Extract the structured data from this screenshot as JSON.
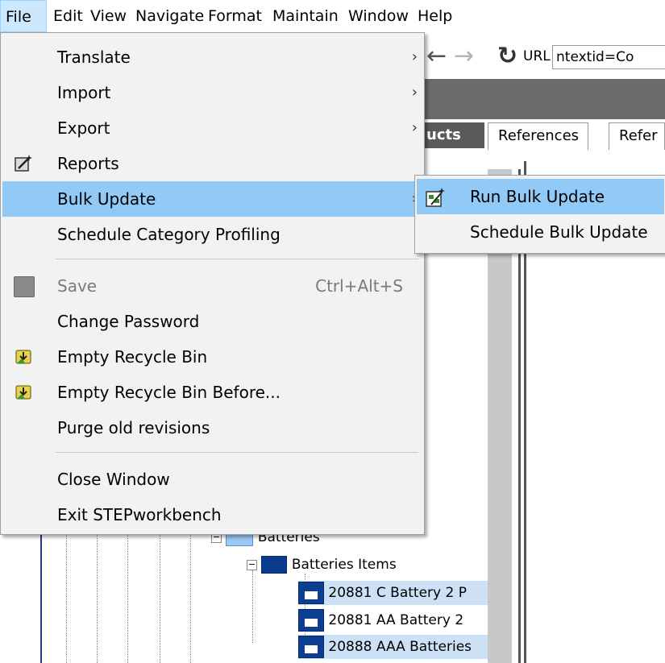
{
  "menubar": {
    "items": [
      "File",
      "Edit",
      "View",
      "Navigate",
      "Format",
      "Maintain",
      "Window",
      "Help"
    ]
  },
  "toolbar": {
    "url_label": "URL",
    "url_value": "ntextid=Co"
  },
  "tabs": {
    "products": "ucts",
    "references": "References",
    "refer": "Refer"
  },
  "tree": {
    "batteries": "Batteries",
    "batteries_items": "Batteries Items",
    "items": [
      {
        "label": "20881 C Battery 2 P",
        "selected": true
      },
      {
        "label": "20881 AA Battery 2",
        "selected": false
      },
      {
        "label": "20888 AAA Batteries",
        "selected": true
      }
    ]
  },
  "file_menu": {
    "translate": "Translate",
    "import": "Import",
    "export": "Export",
    "reports": "Reports",
    "bulk_update": "Bulk Update",
    "schedule_category_profiling": "Schedule Category Profiling",
    "save": "Save",
    "save_shortcut": "Ctrl+Alt+S",
    "change_password": "Change Password",
    "empty_recycle_bin": "Empty Recycle Bin",
    "empty_recycle_bin_before": "Empty Recycle Bin Before...",
    "purge_old_revisions": "Purge old revisions",
    "close_window": "Close Window",
    "exit": "Exit STEPworkbench"
  },
  "bulk_update_submenu": {
    "run_bulk_update": "Run Bulk Update",
    "schedule_bulk_update": "Schedule Bulk Update"
  },
  "icons": {
    "back": "arrow-left-icon",
    "forward": "arrow-right-icon",
    "refresh": "refresh-icon",
    "reports": "wand-icon",
    "save": "floppy-disk-icon",
    "recycle": "recycle-bin-icon",
    "run_bulk": "bulk-update-icon"
  },
  "colors": {
    "highlight": "#91c9f7",
    "menubar_active": "#cce8ff",
    "selection": "#cce1f6",
    "item_icon": "#0b3d91"
  }
}
